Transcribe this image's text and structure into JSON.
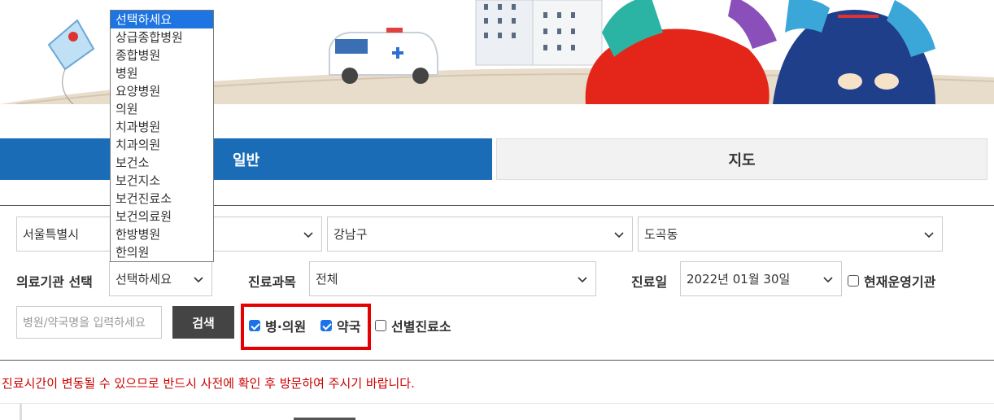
{
  "tabs": {
    "general": "일반",
    "map": "지도"
  },
  "region": {
    "city": "서울특별시",
    "district": "강남구",
    "dong": "도곡동"
  },
  "facility": {
    "label": "의료기관 선택",
    "value": "선택하세요"
  },
  "department": {
    "label": "진료과목",
    "value": "전체"
  },
  "date": {
    "label": "진료일",
    "value": "2022년 01월 30일"
  },
  "operating_now": {
    "label": "현재운영기관",
    "checked": false
  },
  "search": {
    "placeholder": "병원/약국명을 입력하세요",
    "button": "검색"
  },
  "filters": [
    {
      "label": "병·의원",
      "checked": true
    },
    {
      "label": "약국",
      "checked": true
    },
    {
      "label": "선별진료소",
      "checked": false
    }
  ],
  "notice": "진료시간이 변동될 수 있으므로 반드시 사전에 확인 후 방문하여 주시기 바랍니다.",
  "dropdown_options": [
    "선택하세요",
    "상급종합병원",
    "종합병원",
    "병원",
    "요양병원",
    "의원",
    "치과병원",
    "치과의원",
    "보건소",
    "보건지소",
    "보건진료소",
    "보건의료원",
    "한방병원",
    "한의원"
  ],
  "colors": {
    "accent": "#1a6cb7",
    "highlight": "#e60000",
    "notice": "#cc0000"
  }
}
